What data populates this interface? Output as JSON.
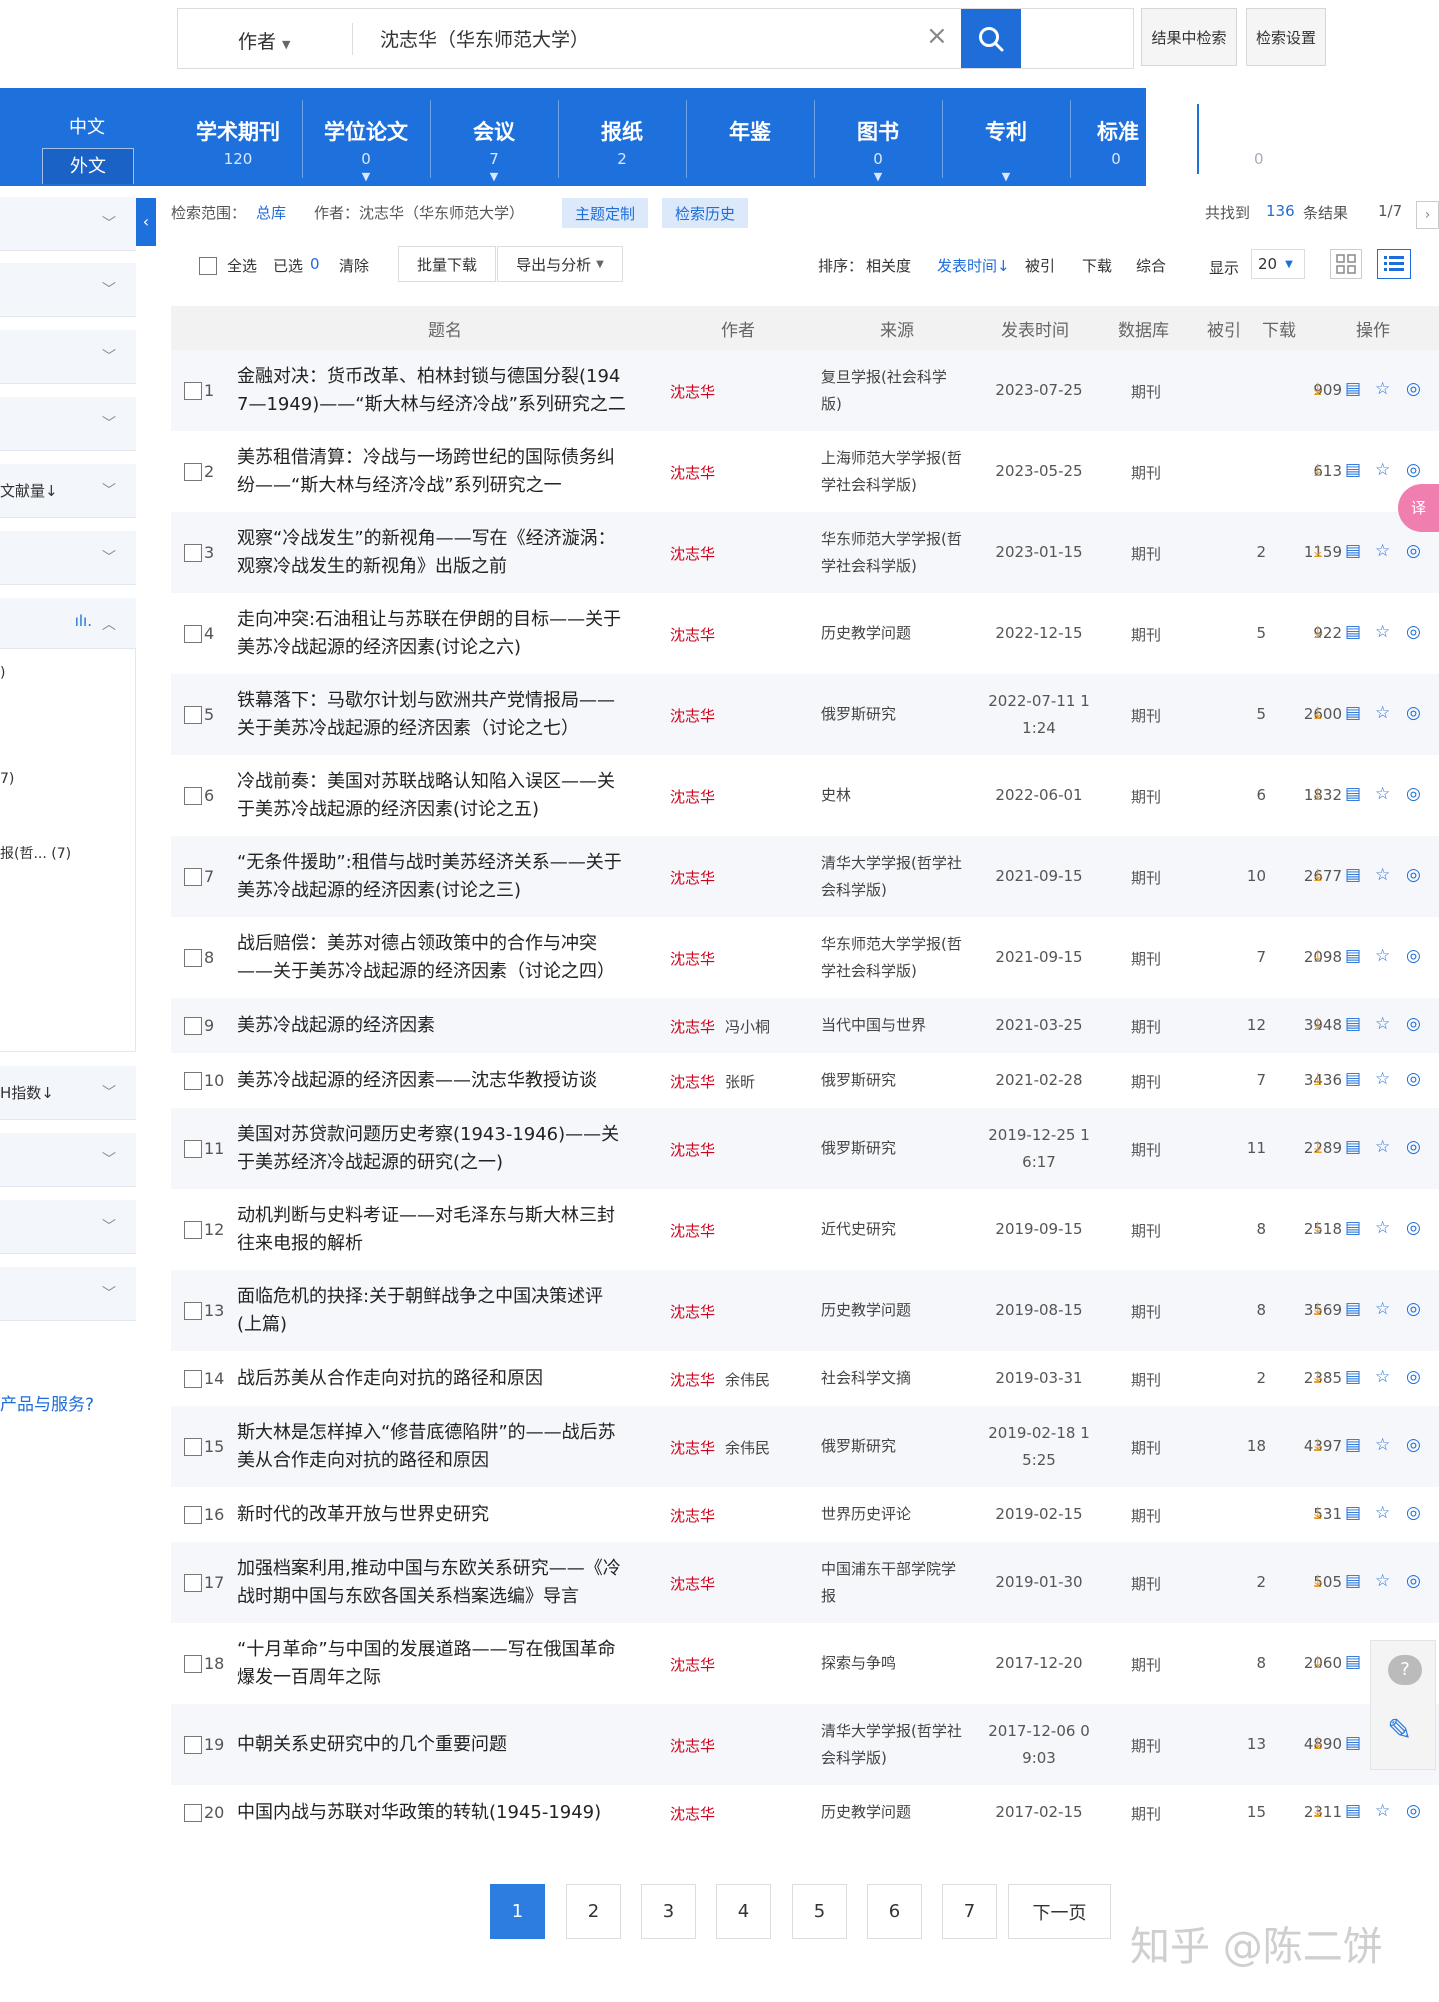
{
  "search": {
    "field": "作者",
    "query": "沈志华（华东师范大学）",
    "refine_label": "结果中检索",
    "settings_label": "检索设置"
  },
  "lang": {
    "zh": "中文",
    "wai": "外文"
  },
  "db_tabs": [
    {
      "name": "学术期刊",
      "count": "120"
    },
    {
      "name": "学位论文",
      "count": "0"
    },
    {
      "name": "会议",
      "count": "7"
    },
    {
      "name": "报纸",
      "count": "2"
    },
    {
      "name": "年鉴",
      "count": ""
    },
    {
      "name": "图书",
      "count": "0"
    },
    {
      "name": "专利",
      "count": ""
    },
    {
      "name": "标准",
      "count": "0"
    }
  ],
  "db_extra_count": "0",
  "sidebar": {
    "items": [
      {
        "label": ""
      },
      {
        "label": ""
      },
      {
        "label": ""
      },
      {
        "label": ""
      },
      {
        "label": "文献量↓"
      },
      {
        "label": ""
      }
    ],
    "panel_rows": [
      ")",
      "7)",
      "报(哲... (7)"
    ],
    "items2": [
      {
        "label": "H指数↓"
      },
      {
        "label": ""
      },
      {
        "label": ""
      },
      {
        "label": ""
      }
    ],
    "help": "产品与服务?"
  },
  "info": {
    "scope_label": "检索范围：",
    "scope": "总库",
    "author": "作者：沈志华（华东师范大学）",
    "theme_btn": "主题定制",
    "history_btn": "检索历史",
    "found_prefix": "共找到",
    "found_count": "136",
    "found_suffix": "条结果",
    "page": "1/7"
  },
  "toolbar": {
    "select_all": "全选",
    "selected_label": "已选",
    "selected_count": "0",
    "clear": "清除",
    "batch_download": "批量下载",
    "export": "导出与分析",
    "sort_label": "排序：",
    "sort_relevance": "相关度",
    "sort_date": "发表时间↓",
    "sort_cited": "被引",
    "sort_download": "下载",
    "sort_combined": "综合",
    "display_label": "显示",
    "display_count": "20"
  },
  "table": {
    "headers": [
      "题名",
      "作者",
      "来源",
      "发表时间",
      "数据库",
      "被引",
      "下载",
      "操作"
    ],
    "rows": [
      {
        "no": "1",
        "title": [
          "金融对决：货币改革、柏林封锁与德国分裂(194",
          "7—1949)——“斯大林与经济冷战”系列研究之二"
        ],
        "author": "沈志华",
        "author2": "",
        "source": [
          "复旦学报(社会科学",
          "版)"
        ],
        "date": [
          "2023-07-25"
        ],
        "db": "期刊",
        "cited": "",
        "downloads": "909"
      },
      {
        "no": "2",
        "title": [
          "美苏租借清算：冷战与一场跨世纪的国际债务纠",
          "纷——“斯大林与经济冷战”系列研究之一"
        ],
        "author": "沈志华",
        "author2": "",
        "source": [
          "上海师范大学学报(哲",
          "学社会科学版)"
        ],
        "date": [
          "2023-05-25"
        ],
        "db": "期刊",
        "cited": "",
        "downloads": "613"
      },
      {
        "no": "3",
        "title": [
          "观察“冷战发生”的新视角——写在《经济漩涡：",
          "观察冷战发生的新视角》出版之前"
        ],
        "author": "沈志华",
        "author2": "",
        "source": [
          "华东师范大学学报(哲",
          "学社会科学版)"
        ],
        "date": [
          "2023-01-15"
        ],
        "db": "期刊",
        "cited": "2",
        "downloads": "1159"
      },
      {
        "no": "4",
        "title": [
          "走向冲突:石油租让与苏联在伊朗的目标——关于",
          "美苏冷战起源的经济因素(讨论之六)"
        ],
        "author": "沈志华",
        "author2": "",
        "source": [
          "历史教学问题"
        ],
        "date": [
          "2022-12-15"
        ],
        "db": "期刊",
        "cited": "5",
        "downloads": "922"
      },
      {
        "no": "5",
        "title": [
          "铁幕落下：马歇尔计划与欧洲共产党情报局——",
          "关于美苏冷战起源的经济因素（讨论之七）"
        ],
        "author": "沈志华",
        "author2": "",
        "source": [
          "俄罗斯研究"
        ],
        "date": [
          "2022-07-11 1",
          "1:24"
        ],
        "db": "期刊",
        "cited": "5",
        "downloads": "2600"
      },
      {
        "no": "6",
        "title": [
          "冷战前奏：美国对苏联战略认知陷入误区——关",
          "于美苏冷战起源的经济因素(讨论之五)"
        ],
        "author": "沈志华",
        "author2": "",
        "source": [
          "史林"
        ],
        "date": [
          "2022-06-01"
        ],
        "db": "期刊",
        "cited": "6",
        "downloads": "1832"
      },
      {
        "no": "7",
        "title": [
          "“无条件援助”:租借与战时美苏经济关系——关于",
          "美苏冷战起源的经济因素(讨论之三)"
        ],
        "author": "沈志华",
        "author2": "",
        "source": [
          "清华大学学报(哲学社",
          "会科学版)"
        ],
        "date": [
          "2021-09-15"
        ],
        "db": "期刊",
        "cited": "10",
        "downloads": "2677"
      },
      {
        "no": "8",
        "title": [
          "战后赔偿：美苏对德占领政策中的合作与冲突",
          "——关于美苏冷战起源的经济因素（讨论之四）"
        ],
        "author": "沈志华",
        "author2": "",
        "source": [
          "华东师范大学学报(哲",
          "学社会科学版)"
        ],
        "date": [
          "2021-09-15"
        ],
        "db": "期刊",
        "cited": "7",
        "downloads": "2098"
      },
      {
        "no": "9",
        "title": [
          "美苏冷战起源的经济因素"
        ],
        "author": "沈志华",
        "author2": "冯小桐",
        "source": [
          "当代中国与世界"
        ],
        "date": [
          "2021-03-25"
        ],
        "db": "期刊",
        "cited": "12",
        "downloads": "3948"
      },
      {
        "no": "10",
        "title": [
          "美苏冷战起源的经济因素——沈志华教授访谈"
        ],
        "author": "沈志华",
        "author2": "张昕",
        "source": [
          "俄罗斯研究"
        ],
        "date": [
          "2021-02-28"
        ],
        "db": "期刊",
        "cited": "7",
        "downloads": "3436"
      },
      {
        "no": "11",
        "title": [
          "美国对苏贷款问题历史考察(1943-1946)——关",
          "于美苏经济冷战起源的研究(之一)"
        ],
        "author": "沈志华",
        "author2": "",
        "source": [
          "俄罗斯研究"
        ],
        "date": [
          "2019-12-25 1",
          "6:17"
        ],
        "db": "期刊",
        "cited": "11",
        "downloads": "2289"
      },
      {
        "no": "12",
        "title": [
          "动机判断与史料考证——对毛泽东与斯大林三封",
          "往来电报的解析"
        ],
        "author": "沈志华",
        "author2": "",
        "source": [
          "近代史研究"
        ],
        "date": [
          "2019-09-15"
        ],
        "db": "期刊",
        "cited": "8",
        "downloads": "2518"
      },
      {
        "no": "13",
        "title": [
          "面临危机的抉择:关于朝鲜战争之中国决策述评",
          "(上篇)"
        ],
        "author": "沈志华",
        "author2": "",
        "source": [
          "历史教学问题"
        ],
        "date": [
          "2019-08-15"
        ],
        "db": "期刊",
        "cited": "8",
        "downloads": "3569"
      },
      {
        "no": "14",
        "title": [
          "战后苏美从合作走向对抗的路径和原因"
        ],
        "author": "沈志华",
        "author2": "余伟民",
        "source": [
          "社会科学文摘"
        ],
        "date": [
          "2019-03-31"
        ],
        "db": "期刊",
        "cited": "2",
        "downloads": "2385"
      },
      {
        "no": "15",
        "title": [
          "斯大林是怎样掉入“修昔底德陷阱”的——战后苏",
          "美从合作走向对抗的路径和原因"
        ],
        "author": "沈志华",
        "author2": "余伟民",
        "source": [
          "俄罗斯研究"
        ],
        "date": [
          "2019-02-18 1",
          "5:25"
        ],
        "db": "期刊",
        "cited": "18",
        "downloads": "4397"
      },
      {
        "no": "16",
        "title": [
          "新时代的改革开放与世界史研究"
        ],
        "author": "沈志华",
        "author2": "",
        "source": [
          "世界历史评论"
        ],
        "date": [
          "2019-02-15"
        ],
        "db": "期刊",
        "cited": "",
        "downloads": "531"
      },
      {
        "no": "17",
        "title": [
          "加强档案利用,推动中国与东欧关系研究——《冷",
          "战时期中国与东欧各国关系档案选编》导言"
        ],
        "author": "沈志华",
        "author2": "",
        "source": [
          "中国浦东干部学院学",
          "报"
        ],
        "date": [
          "2019-01-30"
        ],
        "db": "期刊",
        "cited": "2",
        "downloads": "505"
      },
      {
        "no": "18",
        "title": [
          "“十月革命”与中国的发展道路——写在俄国革命",
          "爆发一百周年之际"
        ],
        "author": "沈志华",
        "author2": "",
        "source": [
          "探索与争鸣"
        ],
        "date": [
          "2017-12-20"
        ],
        "db": "期刊",
        "cited": "8",
        "downloads": "2060"
      },
      {
        "no": "19",
        "title": [
          "中朝关系史研究中的几个重要问题"
        ],
        "author": "沈志华",
        "author2": "",
        "source": [
          "清华大学学报(哲学社",
          "会科学版)"
        ],
        "date": [
          "2017-12-06 0",
          "9:03"
        ],
        "db": "期刊",
        "cited": "13",
        "downloads": "4890"
      },
      {
        "no": "20",
        "title": [
          "中国内战与苏联对华政策的转轨(1945-1949)"
        ],
        "author": "沈志华",
        "author2": "",
        "source": [
          "历史教学问题"
        ],
        "date": [
          "2017-02-15"
        ],
        "db": "期刊",
        "cited": "15",
        "downloads": "2311"
      }
    ]
  },
  "pagination": {
    "pages": [
      "1",
      "2",
      "3",
      "4",
      "5",
      "6",
      "7"
    ],
    "next": "下一页",
    "current": "1"
  },
  "watermark": "知乎 @陈二饼",
  "float_badge": "译",
  "colors": {
    "primary": "#1e70dc",
    "author_red": "#d0021b",
    "download_orange": "#e59a2a"
  }
}
